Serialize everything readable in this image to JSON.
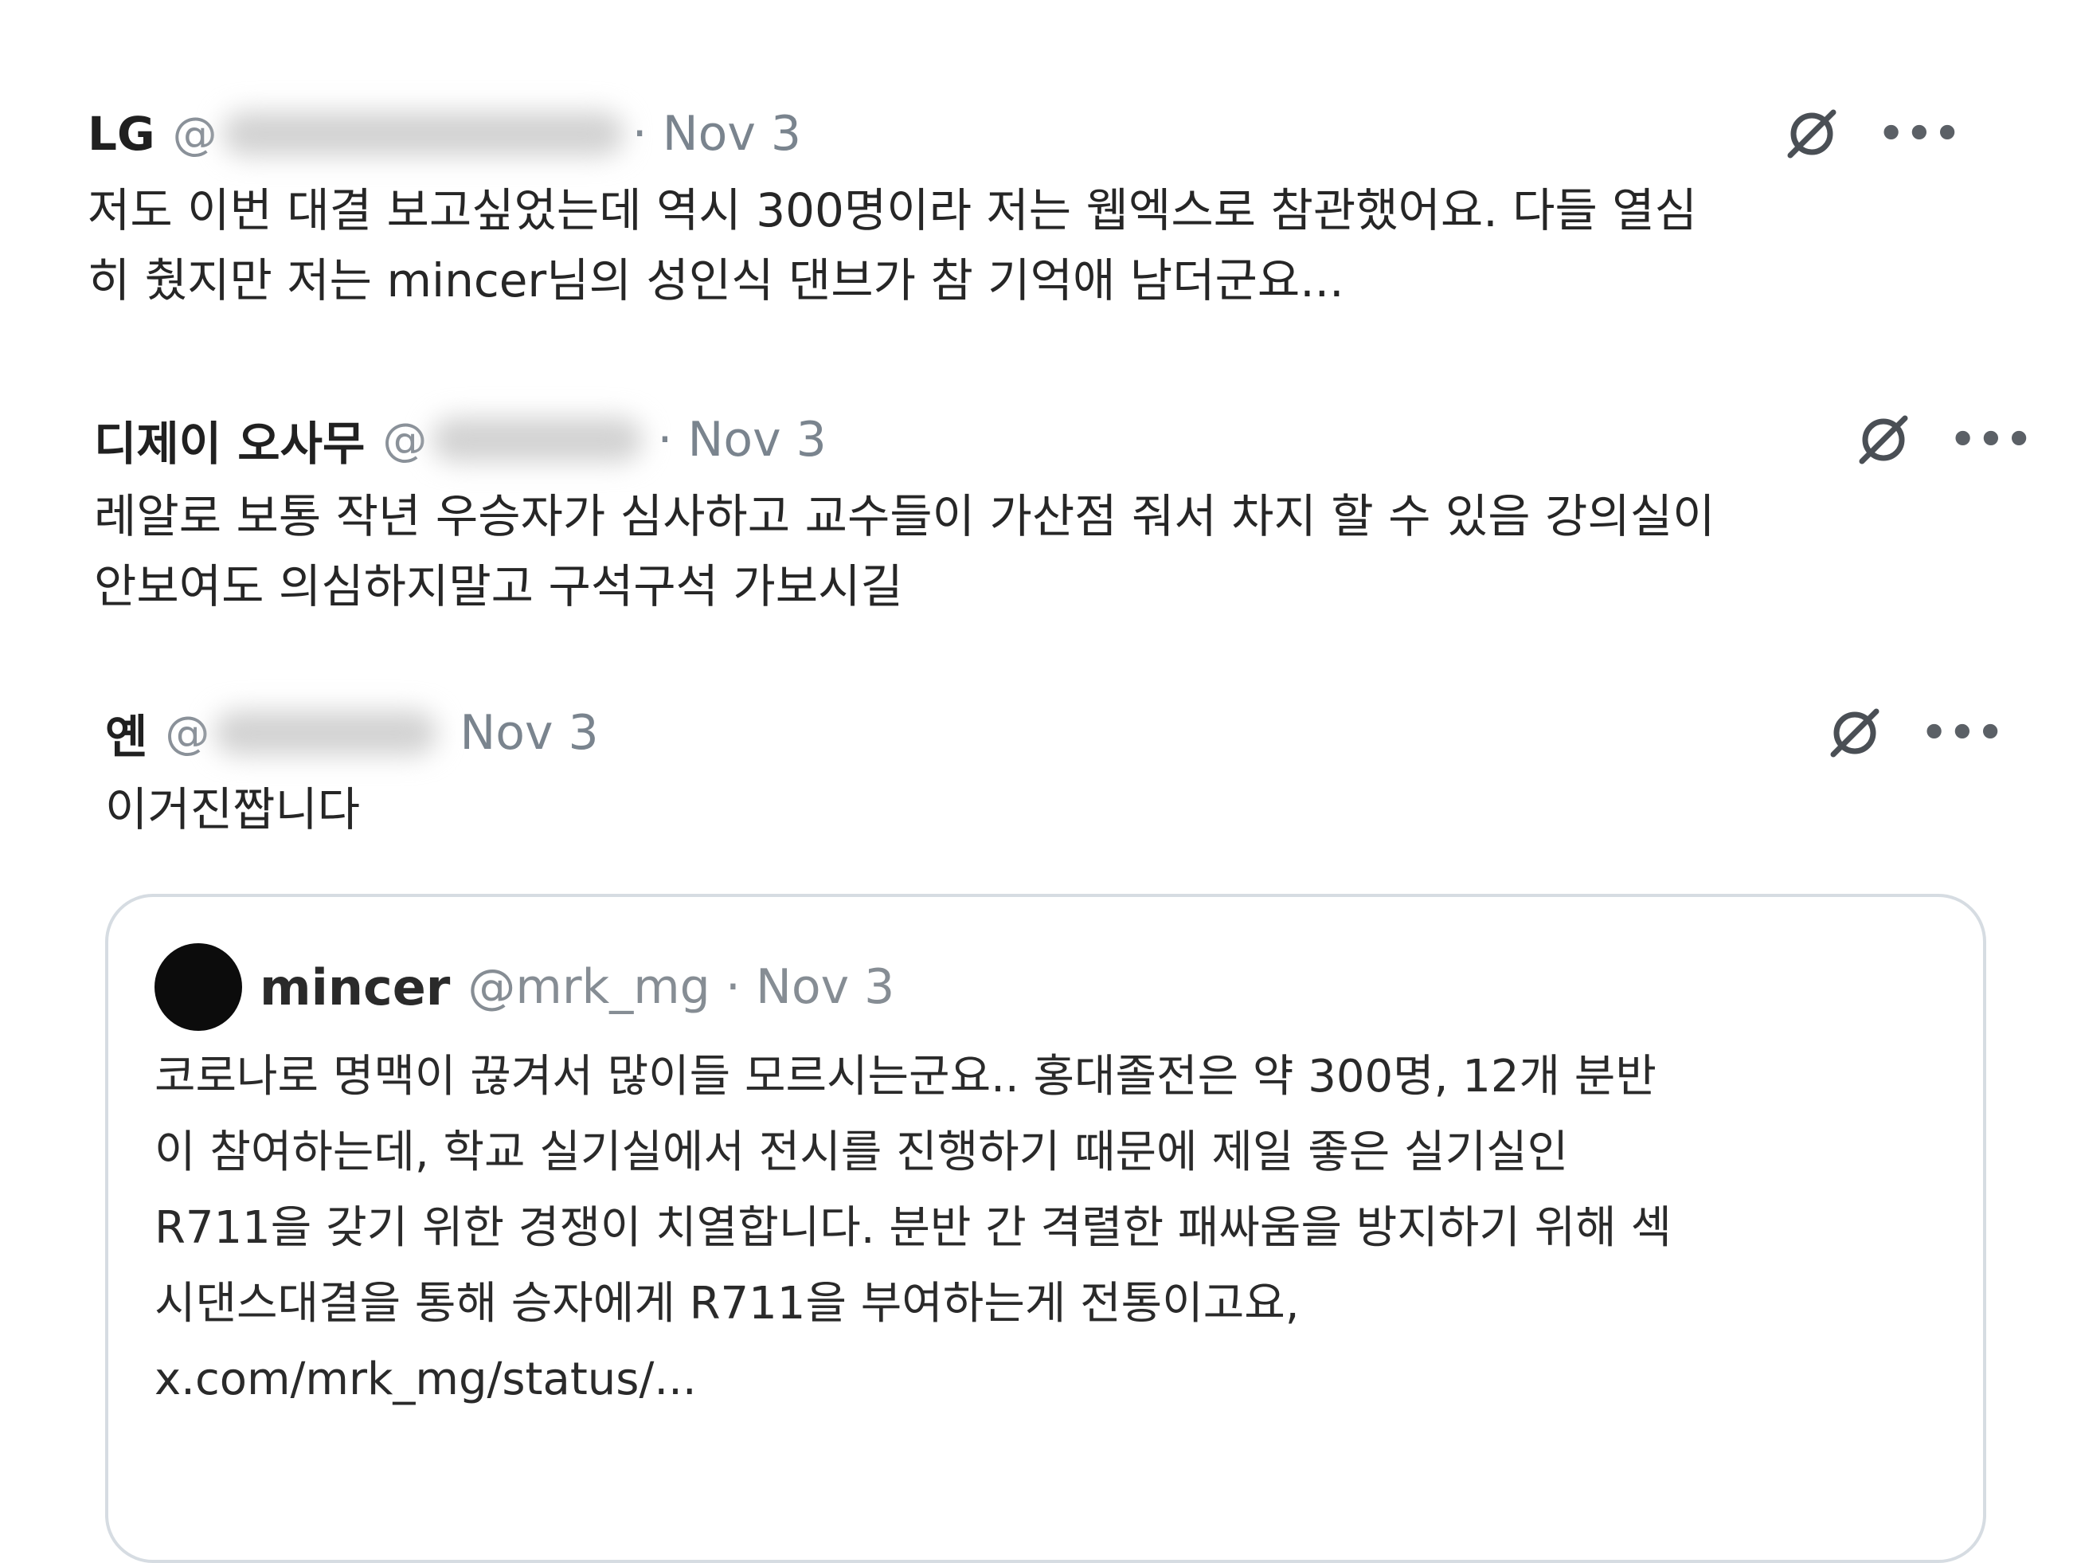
{
  "posts": [
    {
      "author": "LG",
      "handle_prefix": "@",
      "date": "· Nov 3",
      "text_lines": [
        "저도 이번 대결 보고싶었는데 역시 300명이라 저는 웹엑스로 참관했어요. 다들 열심",
        "히 췄지만 저는 mincer님의 성인식 댄브가 참 기억애 남더군요..."
      ]
    },
    {
      "author": "디제이 오사무",
      "handle_prefix": "@",
      "date": "· Nov 3",
      "text_lines": [
        "레알로 보통 작년 우승자가 심사하고 교수들이 가산점 줘서 차지 할 수 있음 강의실이",
        "안보여도 의심하지말고 구석구석 가보시길"
      ]
    },
    {
      "author": "옌",
      "handle_prefix": "@",
      "date": "Nov 3",
      "text_lines": [
        "이거진짭니다"
      ],
      "quote": {
        "author": "mincer",
        "handle": "@mrk_mg · Nov 3",
        "text_lines": [
          "코로나로 명맥이 끊겨서 많이들 모르시는군요.. 홍대졸전은 약 300명, 12개 분반",
          "이 참여하는데, 학교 실기실에서 전시를 진행하기 때문에 제일 좋은 실기실인",
          "R711을 갖기 위한 경쟁이 치열합니다. 분반 간 격렬한 패싸움을 방지하기 위해 섹",
          "시댄스대결을 통해 승자에게 R711을 부여하는게 전통이고요,",
          "x.com/mrk_mg/status/..."
        ]
      }
    }
  ],
  "icons": {
    "grok": "grok-icon",
    "more": "more-options-icon",
    "more_glyph": "•••"
  },
  "colors": {
    "text": "#262626",
    "muted": "#7a848e",
    "border": "#d6dce2"
  }
}
